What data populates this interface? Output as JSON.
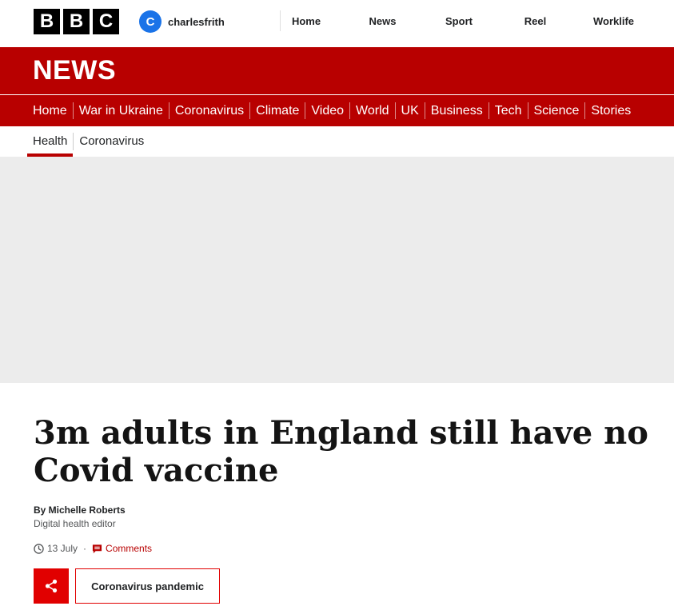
{
  "brand": {
    "letters": [
      "B",
      "B",
      "C"
    ]
  },
  "account": {
    "initial": "C",
    "username": "charlesfrith"
  },
  "top_nav": [
    "Home",
    "News",
    "Sport",
    "Reel",
    "Worklife"
  ],
  "news_title": "NEWS",
  "section_nav": [
    "Home",
    "War in Ukraine",
    "Coronavirus",
    "Climate",
    "Video",
    "World",
    "UK",
    "Business",
    "Tech",
    "Science",
    "Stories"
  ],
  "sub_nav": {
    "active": "Health",
    "other": "Coronavirus"
  },
  "article": {
    "headline_line1": "3m adults in England still have no",
    "headline_line2": "Covid vaccine",
    "author": "By Michelle Roberts",
    "role": "Digital health editor",
    "date": "13 July",
    "separator": "·",
    "comments_label": "Comments",
    "topic_button": "Coronavirus pandemic"
  },
  "icons": {
    "clock": "clock-icon",
    "comment": "comment-icon",
    "share": "share-icon"
  },
  "colors": {
    "brand_red": "#b80000",
    "share_red": "#e10000",
    "avatar_blue": "#1a73e8",
    "hero_grey": "#ececec"
  }
}
